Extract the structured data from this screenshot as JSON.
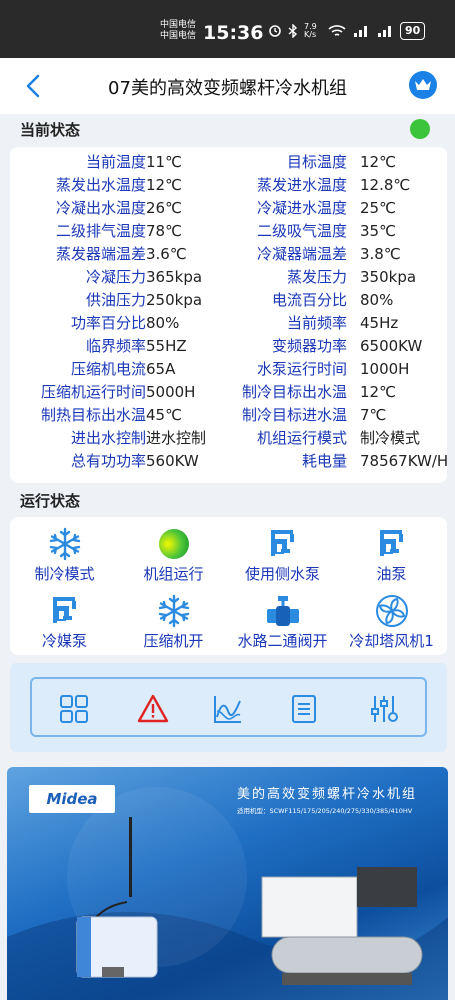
{
  "status_bar": {
    "carrier1": "中国电信",
    "carrier2": "中国电信",
    "time": "15:36",
    "speed": "7.9 K/s",
    "battery": "90"
  },
  "header": {
    "title": "07美的高效变频螺杆冷水机组"
  },
  "current_status": {
    "section_title": "当前状态",
    "indicator_color": "#3cc53c",
    "rows": [
      {
        "l1": "当前温度",
        "v1": "11℃",
        "l2": "目标温度",
        "v2": "12℃"
      },
      {
        "l1": "蒸发出水温度",
        "v1": "12℃",
        "l2": "蒸发进水温度",
        "v2": "12.8℃"
      },
      {
        "l1": "冷凝出水温度",
        "v1": "26℃",
        "l2": "冷凝进水温度",
        "v2": "25℃"
      },
      {
        "l1": "二级排气温度",
        "v1": "78℃",
        "l2": "二级吸气温度",
        "v2": "35℃"
      },
      {
        "l1": "蒸发器端温差",
        "v1": "3.6℃",
        "l2": "冷凝器端温差",
        "v2": "3.8℃"
      },
      {
        "l1": "冷凝压力",
        "v1": "365kpa",
        "l2": "蒸发压力",
        "v2": "350kpa"
      },
      {
        "l1": "供油压力",
        "v1": "250kpa",
        "l2": "电流百分比",
        "v2": "80%"
      },
      {
        "l1": "功率百分比",
        "v1": "80%",
        "l2": "当前频率",
        "v2": "45Hz"
      },
      {
        "l1": "临界频率",
        "v1": "55HZ",
        "l2": "变频器功率",
        "v2": "6500KW"
      },
      {
        "l1": "压缩机电流",
        "v1": "65A",
        "l2": "水泵运行时间",
        "v2": "1000H"
      },
      {
        "l1": "压缩机运行时间",
        "v1": "5000H",
        "l2": "制冷目标出水温",
        "v2": "12℃"
      },
      {
        "l1": "制热目标出水温",
        "v1": "45℃",
        "l2": "制冷目标进水温",
        "v2": "7℃"
      },
      {
        "l1": "进出水控制",
        "v1": "进水控制",
        "l2": "机组运行模式",
        "v2": "制冷模式"
      },
      {
        "l1": "总有功功率",
        "v1": "560KW",
        "l2": "耗电量",
        "v2": "78567KW/H"
      }
    ]
  },
  "run_status": {
    "section_title": "运行状态",
    "items": [
      {
        "label": "制冷模式",
        "icon": "snowflake-icon"
      },
      {
        "label": "机组运行",
        "icon": "running-indicator-icon"
      },
      {
        "label": "使用侧水泵",
        "icon": "pump-icon"
      },
      {
        "label": "油泵",
        "icon": "pump-icon"
      },
      {
        "label": "冷媒泵",
        "icon": "pump-icon"
      },
      {
        "label": "压缩机开",
        "icon": "snowflake-icon"
      },
      {
        "label": "水路二通阀开",
        "icon": "valve-icon"
      },
      {
        "label": "冷却塔风机1",
        "icon": "fan-icon"
      }
    ]
  },
  "toolbar": {
    "items": [
      {
        "icon": "dashboard-grid-icon"
      },
      {
        "icon": "alarm-warning-icon"
      },
      {
        "icon": "chart-curve-icon"
      },
      {
        "icon": "list-document-icon"
      },
      {
        "icon": "settings-sliders-icon"
      }
    ]
  },
  "banner": {
    "brand": "Midea",
    "title": "美的高效变频螺杆冷水机组",
    "subtitle": "适用机型：SCWF115/175/205/240/275/330/385/410HV"
  },
  "colors": {
    "label_blue": "#1b38b8",
    "accent_blue": "#1a82e6",
    "panel_bg": "#dcecfa"
  }
}
